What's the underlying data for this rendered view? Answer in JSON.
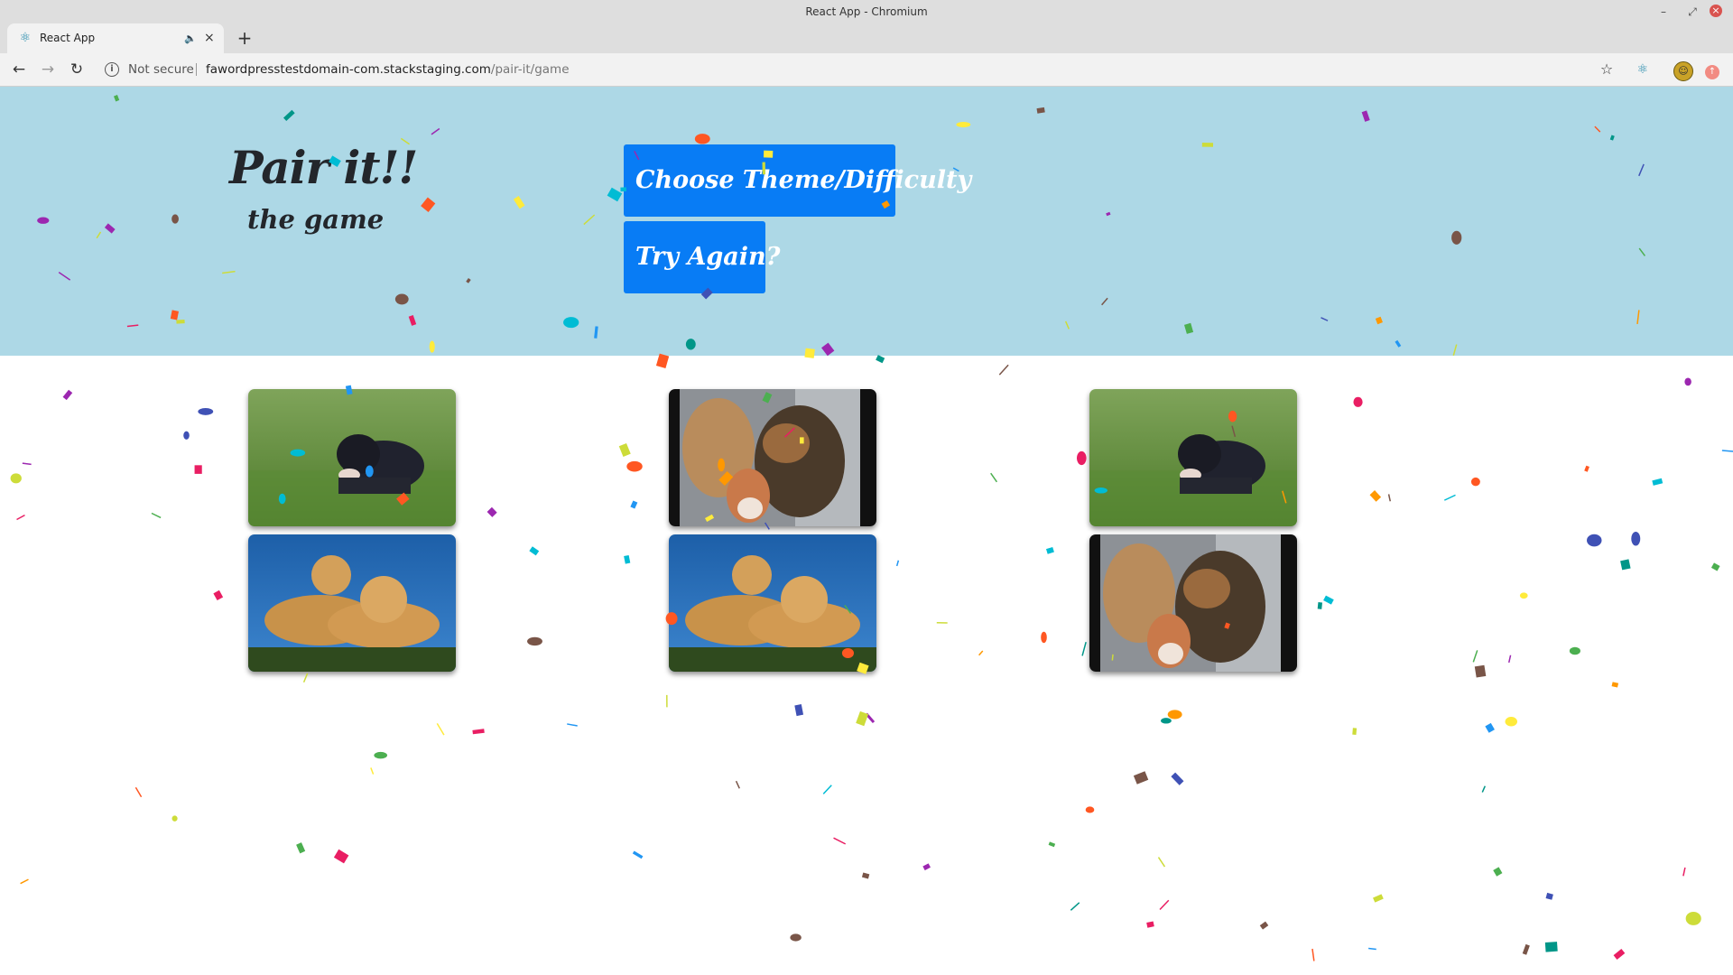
{
  "window": {
    "title": "React App - Chromium"
  },
  "tab": {
    "label": "React App"
  },
  "address_bar": {
    "security": "Not secure",
    "host": "fawordpresstestdomain-com.stackstaging.com",
    "path": "/pair-it/game"
  },
  "hero": {
    "title": "Pair it!!",
    "subtitle": "the game",
    "theme_button": "Choose Theme/Difficulty",
    "retry_button": "Try Again?"
  },
  "cards": [
    {
      "image": "black-lab-puppy-on-grass"
    },
    {
      "image": "german-shepherds-and-small-dog"
    },
    {
      "image": "black-lab-puppy-on-grass"
    },
    {
      "image": "two-golden-retrievers-blue-sky"
    },
    {
      "image": "two-golden-retrievers-blue-sky"
    },
    {
      "image": "german-shepherds-and-small-dog"
    }
  ],
  "confetti_colors": [
    "#e91e63",
    "#2196f3",
    "#4caf50",
    "#ffeb3b",
    "#ff5722",
    "#9c27b0",
    "#795548",
    "#3f51b5",
    "#00bcd4",
    "#ff9800",
    "#009688",
    "#cddc39"
  ],
  "icons": {
    "favicon": "react-icon",
    "audio": "speaker-icon",
    "back": "back-arrow-icon",
    "forward": "forward-arrow-icon",
    "reload": "reload-icon",
    "info": "info-icon",
    "bookmark": "star-icon",
    "extension": "react-devtools-icon",
    "profile": "profile-avatar-icon",
    "update": "update-icon"
  }
}
